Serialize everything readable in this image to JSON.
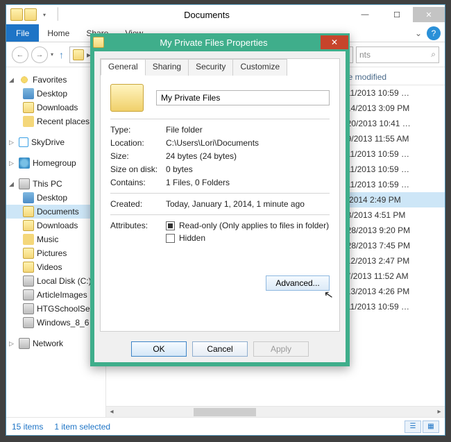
{
  "window": {
    "title": "Documents",
    "ribbon": {
      "file": "File",
      "tabs": [
        "Home",
        "Share",
        "View"
      ]
    },
    "breadcrumb": {
      "refresh_icon": "⟳"
    },
    "search": {
      "placeholder": "nts",
      "icon": "⌕"
    },
    "sidebar": {
      "favorites": {
        "label": "Favorites",
        "items": [
          "Desktop",
          "Downloads",
          "Recent places"
        ]
      },
      "skydrive": "SkyDrive",
      "homegroup": "Homegroup",
      "thispc": {
        "label": "This PC",
        "items": [
          "Desktop",
          "Documents",
          "Downloads",
          "Music",
          "Pictures",
          "Videos",
          "Local Disk (C:)",
          "ArticleImages",
          "HTGSchoolSe",
          "Windows_8_6"
        ]
      },
      "network": "Network"
    },
    "list": {
      "header_date": "Date modified",
      "rows": [
        {
          "date": "11/11/2013 10:59 …",
          "sel": false
        },
        {
          "date": "11/14/2013 3:09 PM",
          "sel": false
        },
        {
          "date": "12/20/2013 10:41 …",
          "sel": false
        },
        {
          "date": "12/9/2013 11:55 AM",
          "sel": false
        },
        {
          "date": "11/11/2013 10:59 …",
          "sel": false
        },
        {
          "date": "11/11/2013 10:59 …",
          "sel": false
        },
        {
          "date": "11/11/2013 10:59 …",
          "sel": false
        },
        {
          "date": "1/1/2014 2:49 PM",
          "sel": true
        },
        {
          "date": "12/3/2013 4:51 PM",
          "sel": false
        },
        {
          "date": "12/28/2013 9:20 PM",
          "sel": false
        },
        {
          "date": "12/28/2013 7:45 PM",
          "sel": false
        },
        {
          "date": "11/12/2013 2:47 PM",
          "sel": false
        },
        {
          "date": "11/7/2013 11:52 AM",
          "sel": false
        },
        {
          "date": "11/13/2013 4:26 PM",
          "sel": false
        },
        {
          "date": "11/11/2013 10:59 …",
          "sel": false
        }
      ]
    },
    "status": {
      "count": "15 items",
      "selection": "1 item selected"
    }
  },
  "dialog": {
    "title": "My Private Files Properties",
    "tabs": [
      "General",
      "Sharing",
      "Security",
      "Customize"
    ],
    "active_tab": "General",
    "folder_name": "My Private Files",
    "type_label": "Type:",
    "type_value": "File folder",
    "location_label": "Location:",
    "location_value": "C:\\Users\\Lori\\Documents",
    "size_label": "Size:",
    "size_value": "24 bytes (24 bytes)",
    "sizedisk_label": "Size on disk:",
    "sizedisk_value": "0 bytes",
    "contains_label": "Contains:",
    "contains_value": "1 Files, 0 Folders",
    "created_label": "Created:",
    "created_value": "Today, January 1, 2014, 1 minute ago",
    "attr_label": "Attributes:",
    "readonly_label": "Read-only (Only applies to files in folder)",
    "hidden_label": "Hidden",
    "advanced": "Advanced...",
    "ok": "OK",
    "cancel": "Cancel",
    "apply": "Apply"
  }
}
